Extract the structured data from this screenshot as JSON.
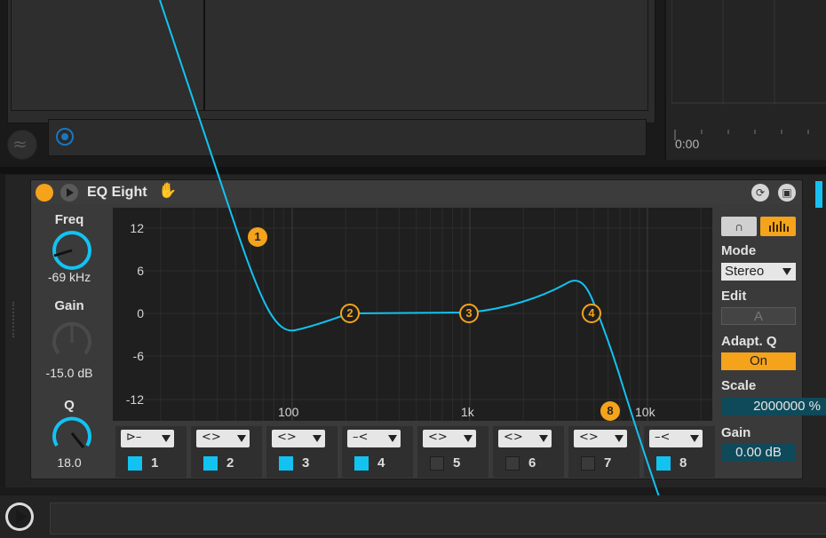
{
  "arrangement": {
    "time": "0:00"
  },
  "device": {
    "title": "EQ Eight",
    "freq": {
      "label": "Freq",
      "value": "-69 kHz"
    },
    "gain": {
      "label": "Gain",
      "value": "-15.0 dB"
    },
    "q": {
      "label": "Q",
      "value": "18.0"
    }
  },
  "graph": {
    "y_labels": [
      "12",
      "6",
      "0",
      "-6",
      "-12"
    ],
    "x_labels": [
      "100",
      "1k",
      "10k"
    ],
    "band_markers": [
      "1",
      "2",
      "3",
      "4",
      "8"
    ]
  },
  "bands": [
    {
      "num": "1",
      "filter_icon": "low-cut-icon",
      "symbol": "⊳–",
      "active": true
    },
    {
      "num": "2",
      "filter_icon": "bell-icon",
      "symbol": "<>",
      "active": true
    },
    {
      "num": "3",
      "filter_icon": "bell-icon",
      "symbol": "<>",
      "active": true
    },
    {
      "num": "4",
      "filter_icon": "high-shelf-icon",
      "symbol": "–<",
      "active": true
    },
    {
      "num": "5",
      "filter_icon": "bell-icon",
      "symbol": "<>",
      "active": false
    },
    {
      "num": "6",
      "filter_icon": "bell-icon",
      "symbol": "<>",
      "active": false
    },
    {
      "num": "7",
      "filter_icon": "bell-icon",
      "symbol": "<>",
      "active": false
    },
    {
      "num": "8",
      "filter_icon": "high-shelf-icon",
      "symbol": "–<",
      "active": true
    }
  ],
  "right_panel": {
    "mode_label": "Mode",
    "mode_value": "Stereo",
    "edit_label": "Edit",
    "edit_value": "A",
    "adapt_label": "Adapt. Q",
    "adapt_value": "On",
    "scale_label": "Scale",
    "scale_value": "2000000 %",
    "gain_label": "Gain",
    "gain_value": "0.00 dB"
  },
  "colors": {
    "accent": "#f4a31b",
    "curve": "#12c3f2",
    "active": "#12c3f2"
  }
}
